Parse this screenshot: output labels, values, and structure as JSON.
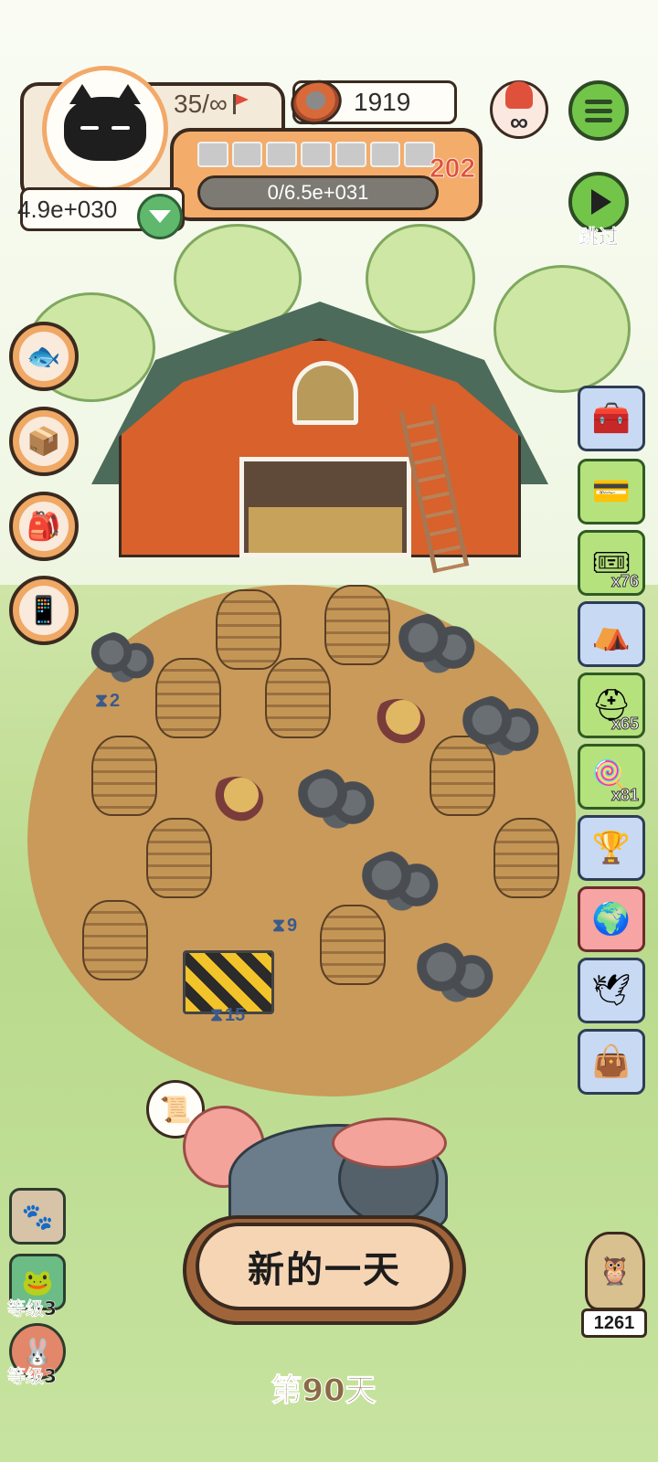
{
  "hud": {
    "stamina": "35/∞",
    "coins": "1919",
    "level": "202",
    "xp_progress": "0/6.5e+031",
    "money": "4.9e+030",
    "skip_label": "跳过"
  },
  "farm": {
    "timers": [
      {
        "value": "2"
      },
      {
        "value": "9"
      },
      {
        "value": "15"
      }
    ]
  },
  "side_panel": {
    "items": [
      {
        "icon": "chest-icon",
        "count": ""
      },
      {
        "icon": "card-icon",
        "count": ""
      },
      {
        "icon": "ticket-icon",
        "count": "x76"
      },
      {
        "icon": "hut-icon",
        "count": ""
      },
      {
        "icon": "helmet-icon",
        "count": "x65"
      },
      {
        "icon": "lollipop-icon",
        "count": "x81"
      },
      {
        "icon": "trophy-icon",
        "count": ""
      },
      {
        "icon": "globe-icon",
        "count": ""
      },
      {
        "icon": "wings-icon",
        "count": ""
      },
      {
        "icon": "bag-icon",
        "count": ""
      }
    ]
  },
  "bottom": {
    "new_day_label": "新的一天",
    "day_label": "第90天",
    "owl_count": "1261",
    "level_badges": [
      {
        "label": "等级3"
      },
      {
        "label": "等级3"
      }
    ]
  }
}
